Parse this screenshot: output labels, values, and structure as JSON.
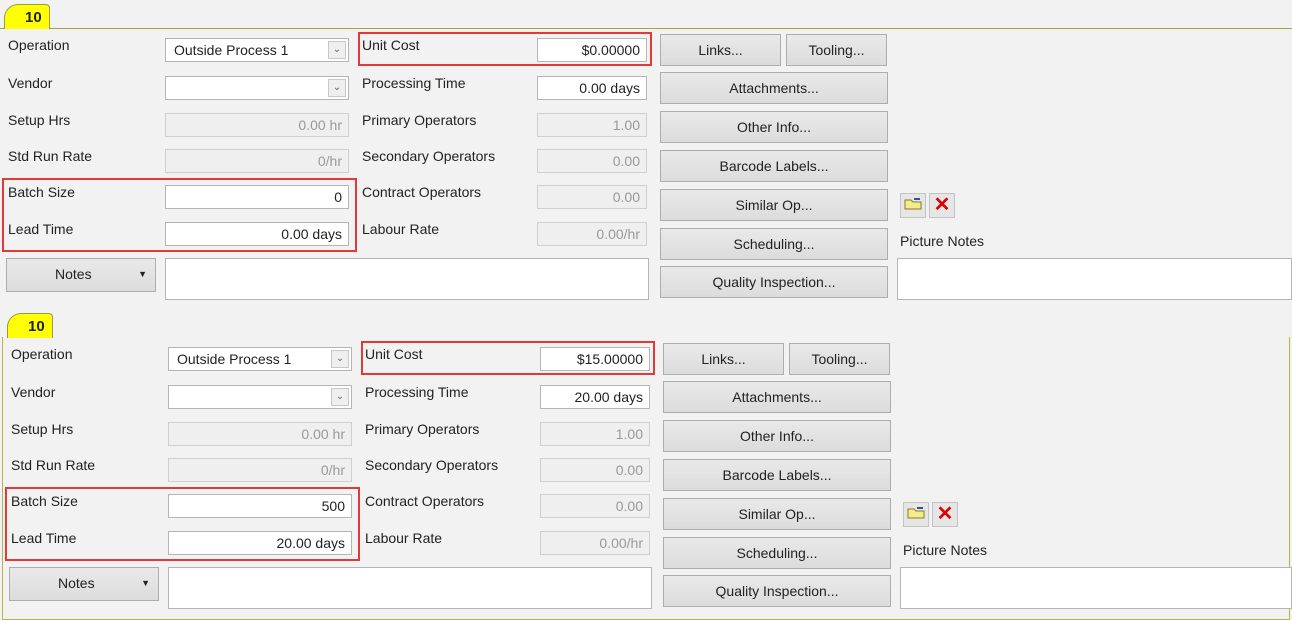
{
  "labels": {
    "operation": "Operation",
    "vendor": "Vendor",
    "setup_hrs": "Setup Hrs",
    "std_run_rate": "Std Run Rate",
    "batch_size": "Batch Size",
    "lead_time": "Lead Time",
    "unit_cost": "Unit Cost",
    "processing_time": "Processing Time",
    "primary_operators": "Primary Operators",
    "secondary_operators": "Secondary Operators",
    "contract_operators": "Contract Operators",
    "labour_rate": "Labour Rate",
    "picture_notes": "Picture Notes",
    "notes": "Notes"
  },
  "buttons": {
    "links": "Links...",
    "tooling": "Tooling...",
    "attachments": "Attachments...",
    "other_info": "Other Info...",
    "barcode_labels": "Barcode Labels...",
    "similar_op": "Similar Op...",
    "scheduling": "Scheduling...",
    "quality_inspection": "Quality Inspection..."
  },
  "accent": {
    "tab": "#ffff00",
    "highlight": "#e03a3a"
  },
  "panels": [
    {
      "tab": "10",
      "operation": "Outside Process 1",
      "vendor": "",
      "setup_hrs": "0.00 hr",
      "std_run_rate": "0/hr",
      "batch_size": "0",
      "lead_time": "0.00 days",
      "unit_cost": "$0.00000",
      "processing_time": "0.00 days",
      "primary_operators": "1.00",
      "secondary_operators": "0.00",
      "contract_operators": "0.00",
      "labour_rate": "0.00/hr",
      "notes": "",
      "picture_notes": ""
    },
    {
      "tab": "10",
      "operation": "Outside Process 1",
      "vendor": "",
      "setup_hrs": "0.00 hr",
      "std_run_rate": "0/hr",
      "batch_size": "500",
      "lead_time": "20.00 days",
      "unit_cost": "$15.00000",
      "processing_time": "20.00 days",
      "primary_operators": "1.00",
      "secondary_operators": "0.00",
      "contract_operators": "0.00",
      "labour_rate": "0.00/hr",
      "notes": "",
      "picture_notes": ""
    }
  ]
}
